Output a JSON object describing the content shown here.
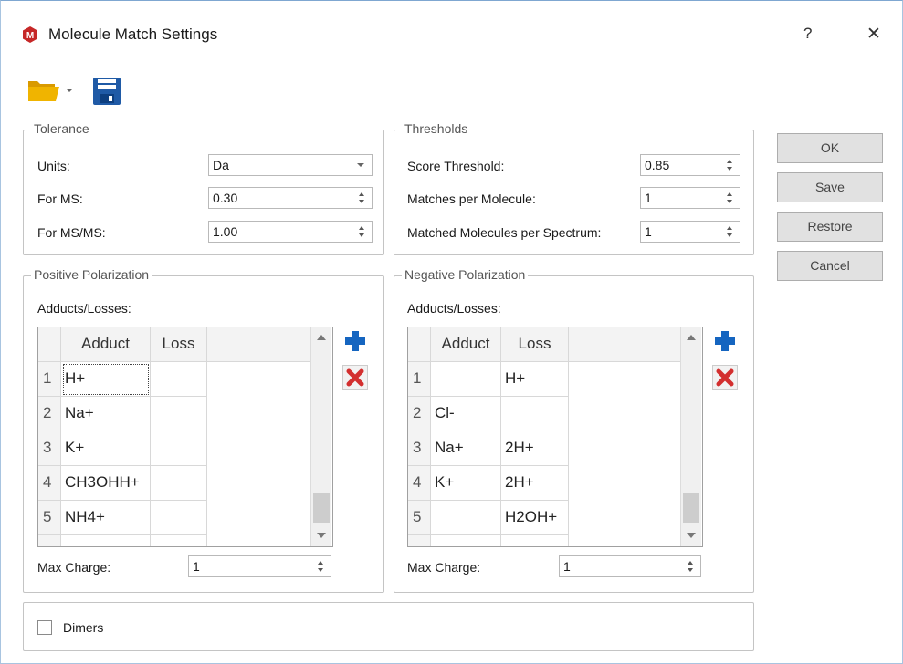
{
  "window": {
    "title": "Molecule Match Settings",
    "help": "?",
    "close": "✕"
  },
  "toolbar": {
    "open_icon": "folder-open-icon",
    "save_icon": "floppy-disk-icon"
  },
  "tolerance": {
    "title": "Tolerance",
    "units_label": "Units:",
    "units_value": "Da",
    "ms_label": "For MS:",
    "ms_value": "0.30",
    "msms_label": "For MS/MS:",
    "msms_value": "1.00"
  },
  "thresholds": {
    "title": "Thresholds",
    "score_label": "Score Threshold:",
    "score_value": "0.85",
    "matches_label": "Matches per Molecule:",
    "matches_value": "1",
    "matched_label": "Matched Molecules per Spectrum:",
    "matched_value": "1"
  },
  "positive": {
    "title": "Positive Polarization",
    "adducts_label": "Adducts/Losses:",
    "col_adduct": "Adduct",
    "col_loss": "Loss",
    "rows": [
      {
        "n": "1",
        "adduct": "H+",
        "loss": ""
      },
      {
        "n": "2",
        "adduct": "Na+",
        "loss": ""
      },
      {
        "n": "3",
        "adduct": "K+",
        "loss": ""
      },
      {
        "n": "4",
        "adduct": "CH3OHH+",
        "loss": ""
      },
      {
        "n": "5",
        "adduct": "NH4+",
        "loss": ""
      }
    ],
    "max_charge_label": "Max Charge:",
    "max_charge_value": "1"
  },
  "negative": {
    "title": "Negative Polarization",
    "adducts_label": "Adducts/Losses:",
    "col_adduct": "Adduct",
    "col_loss": "Loss",
    "rows": [
      {
        "n": "1",
        "adduct": "",
        "loss": "H+"
      },
      {
        "n": "2",
        "adduct": "Cl-",
        "loss": ""
      },
      {
        "n": "3",
        "adduct": "Na+",
        "loss": "2H+"
      },
      {
        "n": "4",
        "adduct": "K+",
        "loss": "2H+"
      },
      {
        "n": "5",
        "adduct": "",
        "loss": "H2OH+"
      }
    ],
    "max_charge_label": "Max Charge:",
    "max_charge_value": "1"
  },
  "dimers": {
    "label": "Dimers",
    "checked": false
  },
  "buttons": {
    "ok": "OK",
    "save": "Save",
    "restore": "Restore",
    "cancel": "Cancel"
  },
  "colors": {
    "accent": "#1565c0",
    "delete": "#d32f2f",
    "folder": "#f0b400",
    "logo": "#c62828"
  }
}
